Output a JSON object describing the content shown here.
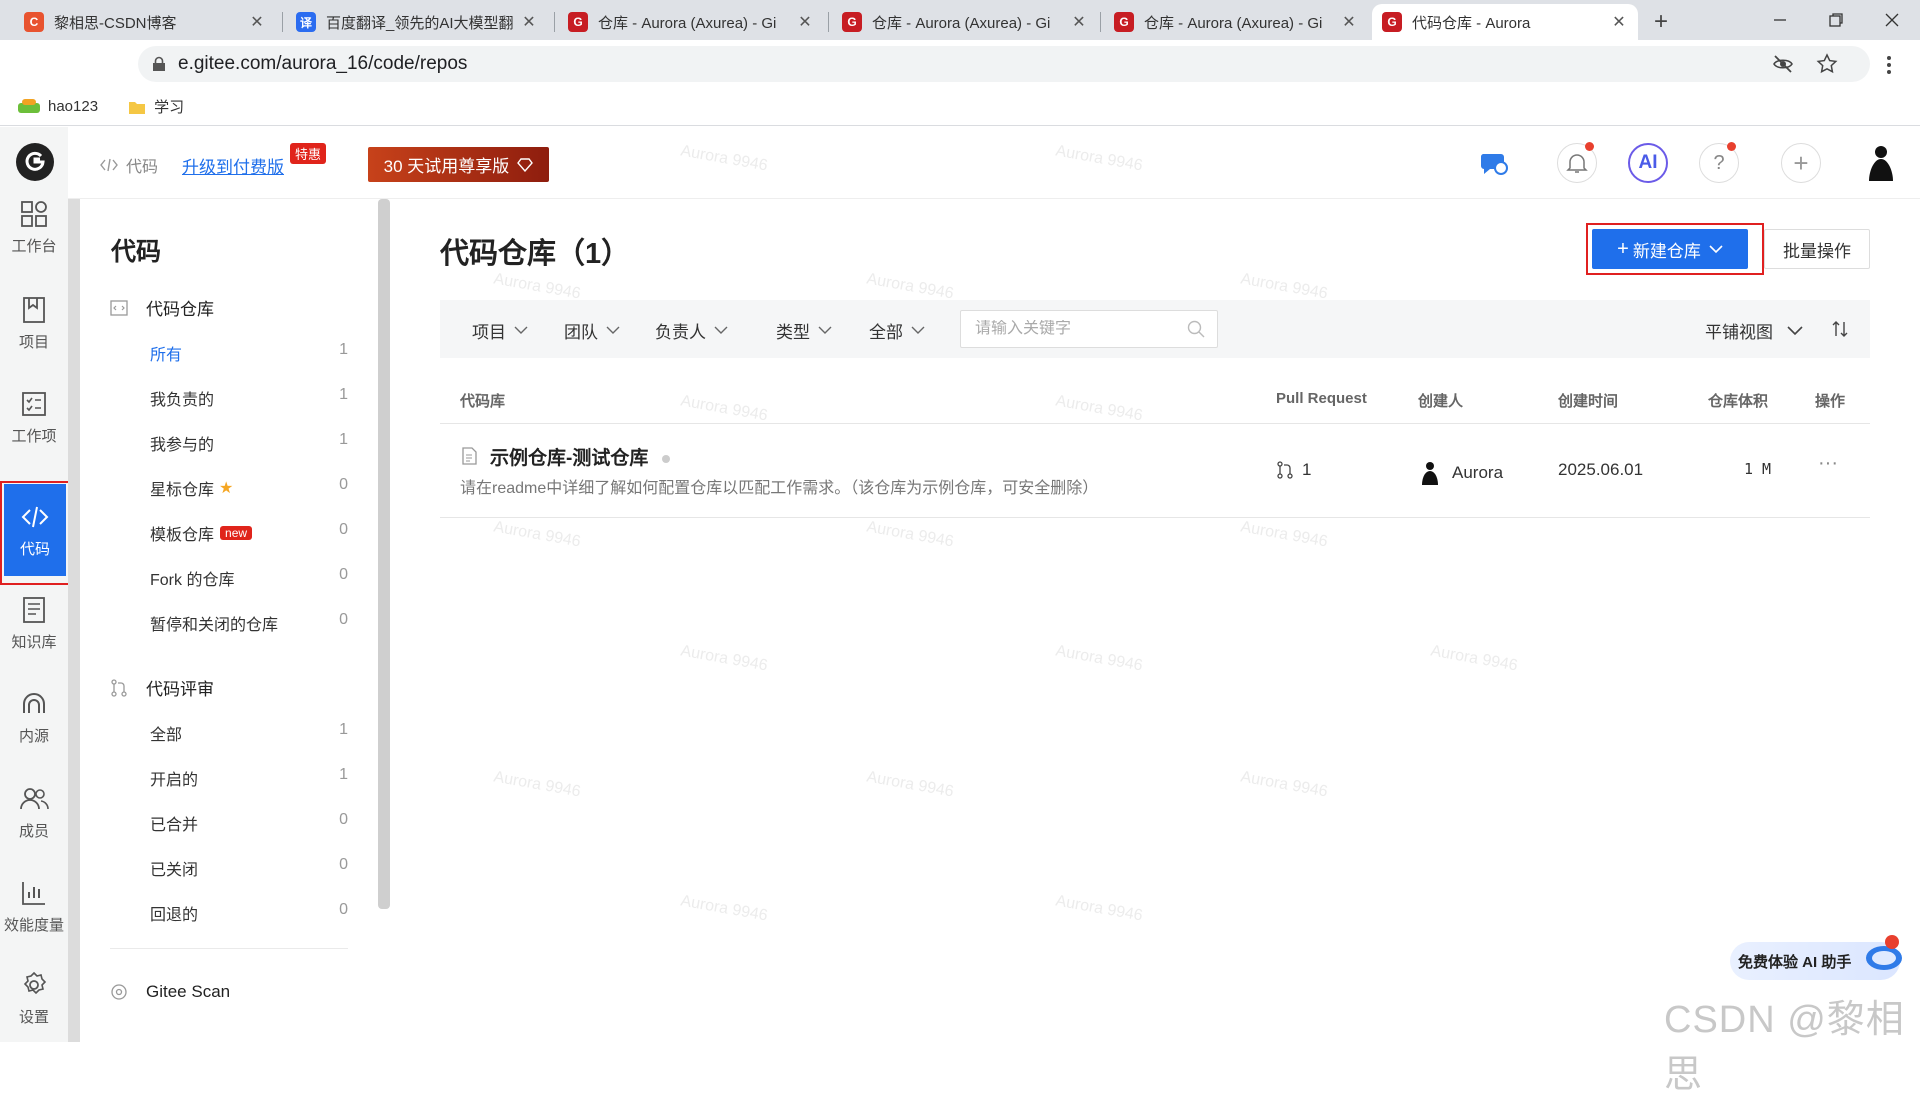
{
  "browser": {
    "tabs": [
      {
        "title": "黎相思-CSDN博客",
        "favicon": "C",
        "color": "#e8532f",
        "active": false
      },
      {
        "title": "百度翻译_领先的AI大模型翻",
        "favicon": "译",
        "color": "#2b6cf0",
        "active": false
      },
      {
        "title": "仓库 - Aurora (Axurea) - Gi",
        "favicon": "G",
        "color": "#c71d23",
        "active": false
      },
      {
        "title": "仓库 - Aurora (Axurea) - Gi",
        "favicon": "G",
        "color": "#c71d23",
        "active": false
      },
      {
        "title": "仓库 - Aurora (Axurea) - Gi",
        "favicon": "G",
        "color": "#c71d23",
        "active": false
      },
      {
        "title": "代码仓库 - Aurora",
        "favicon": "G",
        "color": "#c71d23",
        "active": true
      }
    ],
    "url": "e.gitee.com/aurora_16/code/repos",
    "bookmarks": [
      "hao123",
      "学习"
    ]
  },
  "header": {
    "breadcrumb": "代码",
    "upgrade": "升级到付费版",
    "tehui": "特惠",
    "trial": "30 天试用尊享版",
    "ai_label": "AI"
  },
  "rail": [
    {
      "label": "工作台",
      "icon": "dashboard-icon",
      "active": false
    },
    {
      "label": "项目",
      "icon": "project-icon",
      "active": false
    },
    {
      "label": "工作项",
      "icon": "task-icon",
      "active": false
    },
    {
      "label": "代码",
      "icon": "code-icon",
      "active": true
    },
    {
      "label": "知识库",
      "icon": "knowledge-icon",
      "active": false
    },
    {
      "label": "内源",
      "icon": "innersource-icon",
      "active": false
    },
    {
      "label": "成员",
      "icon": "members-icon",
      "active": false
    },
    {
      "label": "效能度量",
      "icon": "metrics-icon",
      "active": false
    },
    {
      "label": "设置",
      "icon": "settings-icon",
      "active": false
    }
  ],
  "sidebar": {
    "title": "代码",
    "repo_section": "代码仓库",
    "repo_items": [
      {
        "label": "所有",
        "count": "1",
        "selected": true
      },
      {
        "label": "我负责的",
        "count": "1"
      },
      {
        "label": "我参与的",
        "count": "1"
      },
      {
        "label": "星标仓库",
        "count": "0",
        "star": true
      },
      {
        "label": "模板仓库",
        "count": "0",
        "badge": "new"
      },
      {
        "label": "Fork 的仓库",
        "count": "0"
      },
      {
        "label": "暂停和关闭的仓库",
        "count": "0"
      }
    ],
    "review_section": "代码评审",
    "review_items": [
      {
        "label": "全部",
        "count": "1"
      },
      {
        "label": "开启的",
        "count": "1"
      },
      {
        "label": "已合并",
        "count": "0"
      },
      {
        "label": "已关闭",
        "count": "0"
      },
      {
        "label": "回退的",
        "count": "0"
      }
    ],
    "scan_section": "Gitee Scan"
  },
  "main": {
    "title": "代码仓库（1）",
    "new_repo": "新建仓库",
    "batch": "批量操作",
    "filters": [
      "项目",
      "团队",
      "负责人",
      "类型",
      "全部"
    ],
    "search_placeholder": "请输入关键字",
    "view_mode": "平铺视图",
    "columns": [
      "代码库",
      "Pull Request",
      "创建人",
      "创建时间",
      "仓库体积",
      "操作"
    ],
    "rows": [
      {
        "name": "示例仓库-测试仓库",
        "description": "请在readme中详细了解如何配置仓库以匹配工作需求。（该仓库为示例仓库，可安全删除）",
        "pull_requests": "1",
        "creator": "Aurora",
        "created": "2025.06.01",
        "size": "1 M",
        "more": "···"
      }
    ]
  },
  "ai_widget": "免费体验 AI 助手",
  "watermark": "Aurora 9946",
  "csdn_watermark": "CSDN @黎相思",
  "colors": {
    "accent": "#1f6feb",
    "danger": "#e0241b",
    "highlight_box": "#e02020"
  }
}
